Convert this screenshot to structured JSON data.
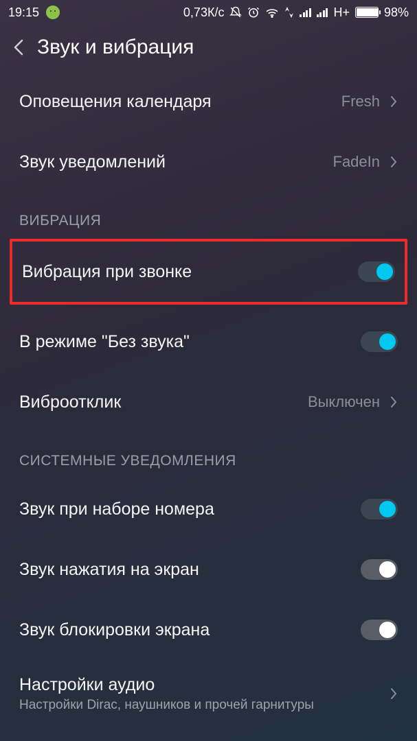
{
  "statusbar": {
    "time": "19:15",
    "speed": "0,73К/с",
    "network": "H+",
    "battery": "98%"
  },
  "header": {
    "title": "Звук и вибрация"
  },
  "rows": {
    "calendar": {
      "label": "Оповещения календаря",
      "value": "Fresh"
    },
    "notif_sound": {
      "label": "Звук уведомлений",
      "value": "FadeIn"
    },
    "vibrate_ring": {
      "label": "Вибрация при звонке"
    },
    "silent_mode": {
      "label": "В режиме \"Без звука\""
    },
    "haptic": {
      "label": "Виброотклик",
      "value": "Выключен"
    },
    "dial_sound": {
      "label": "Звук при наборе номера"
    },
    "tap_sound": {
      "label": "Звук нажатия на экран"
    },
    "lock_sound": {
      "label": "Звук блокировки экрана"
    },
    "audio_settings": {
      "label": "Настройки аудио",
      "sub": "Настройки Dirac, наушников и прочей гарнитуры"
    }
  },
  "sections": {
    "vibration": "ВИБРАЦИЯ",
    "system_notif": "СИСТЕМНЫЕ УВЕДОМЛЕНИЯ"
  }
}
